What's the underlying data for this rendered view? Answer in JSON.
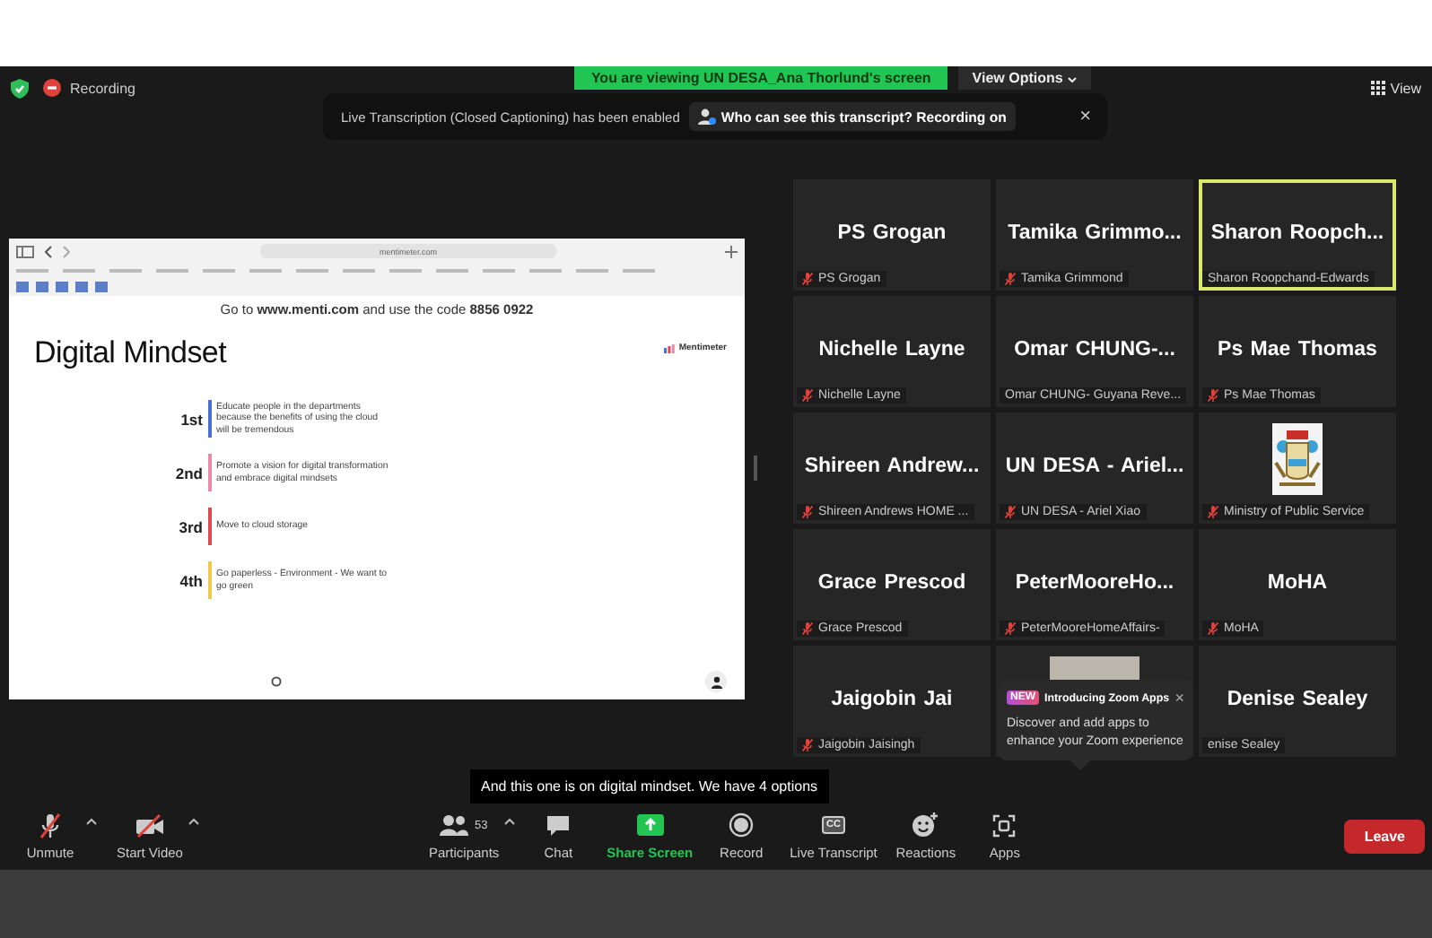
{
  "header": {
    "recording": "Recording",
    "viewing_banner": "You are viewing UN DESA_Ana Thorlund's screen",
    "view_options": "View Options",
    "view": "View"
  },
  "notice": {
    "text": "Live Transcription (Closed Captioning) has been enabled",
    "action": "Who can see this transcript? Recording on",
    "close": "×"
  },
  "shared_screen": {
    "url": "mentimeter.com",
    "slide": {
      "instruction": "Go to **www.menti.com** and use the code **8856 0922**",
      "title": "Digital Mindset",
      "brand": "Mentimeter",
      "ranks": [
        {
          "rank": "1st",
          "text": "Educate people in the departments because the benefits of using the cloud will be tremendous",
          "color": "#4a6fd8"
        },
        {
          "rank": "2nd",
          "text": "Promote a vision for digital transformation and embrace digital mindsets",
          "color": "#e88aa8"
        },
        {
          "rank": "3rd",
          "text": "Move to cloud storage",
          "color": "#e0484f"
        },
        {
          "rank": "4th",
          "text": "Go paperless - Environment - We want to go green",
          "color": "#f0c84a"
        }
      ]
    }
  },
  "participants": [
    {
      "kind": "name",
      "name": "PS Grogan",
      "label": "PS Grogan",
      "muted": true,
      "speaking": false
    },
    {
      "kind": "name",
      "name": "Tamika  Grimmo...",
      "label": "Tamika Grimmond",
      "muted": true,
      "speaking": false
    },
    {
      "kind": "name",
      "name": "Sharon  Roopch...",
      "label": "Sharon Roopchand-Edwards",
      "muted": false,
      "speaking": true
    },
    {
      "kind": "name",
      "name": "Nichelle Layne",
      "label": "Nichelle Layne",
      "muted": true,
      "speaking": false
    },
    {
      "kind": "name",
      "name": "Omar  CHUNG-...",
      "label": "Omar CHUNG- Guyana Reve...",
      "muted": false,
      "speaking": false
    },
    {
      "kind": "name",
      "name": "Ps Mae Thomas",
      "label": "Ps Mae Thomas",
      "muted": true,
      "speaking": false
    },
    {
      "kind": "name",
      "name": "Shireen  Andrew...",
      "label": "Shireen Andrews HOME ...",
      "muted": true,
      "speaking": false
    },
    {
      "kind": "name",
      "name": "UN DESA - Ariel...",
      "label": "UN DESA - Ariel Xiao",
      "muted": true,
      "speaking": false
    },
    {
      "kind": "logo",
      "label": "Ministry of Public Service",
      "muted": true,
      "speaking": false
    },
    {
      "kind": "name",
      "name": "Grace Prescod",
      "label": "Grace Prescod",
      "muted": true,
      "speaking": false
    },
    {
      "kind": "name",
      "name": "PeterMooreHo...",
      "label": "PeterMooreHomeAffairs-",
      "muted": true,
      "speaking": false
    },
    {
      "kind": "name",
      "name": "MoHA",
      "label": "MoHA",
      "muted": true,
      "speaking": false
    },
    {
      "kind": "name",
      "name": "Jaigobin Jai",
      "label": "Jaigobin Jaisingh",
      "muted": true,
      "speaking": false
    },
    {
      "kind": "photo",
      "speaking": false
    },
    {
      "kind": "name",
      "name": "Denise Sealey",
      "label": "enise Sealey",
      "muted": false,
      "speaking": false
    }
  ],
  "caption": "And this one is on digital mindset. We have 4 options",
  "popup": {
    "badge": "NEW",
    "title": "Introducing Zoom Apps",
    "body": "Discover and add apps to enhance your Zoom experience",
    "close": "×"
  },
  "toolbar": [
    {
      "kind": "mic",
      "label": "Unmute",
      "off": true,
      "has_menu": true
    },
    {
      "kind": "video",
      "label": "Start Video",
      "off": true,
      "has_menu": true
    },
    {
      "kind": "participants",
      "label": "Participants",
      "count": "53",
      "has_menu": true
    },
    {
      "kind": "chat",
      "label": "Chat"
    },
    {
      "kind": "share",
      "label": "Share Screen"
    },
    {
      "kind": "record",
      "label": "Record"
    },
    {
      "kind": "cc",
      "label": "Live Transcript",
      "badge": "CC"
    },
    {
      "kind": "reactions",
      "label": "Reactions"
    },
    {
      "kind": "apps",
      "label": "Apps"
    }
  ],
  "leave": "Leave"
}
